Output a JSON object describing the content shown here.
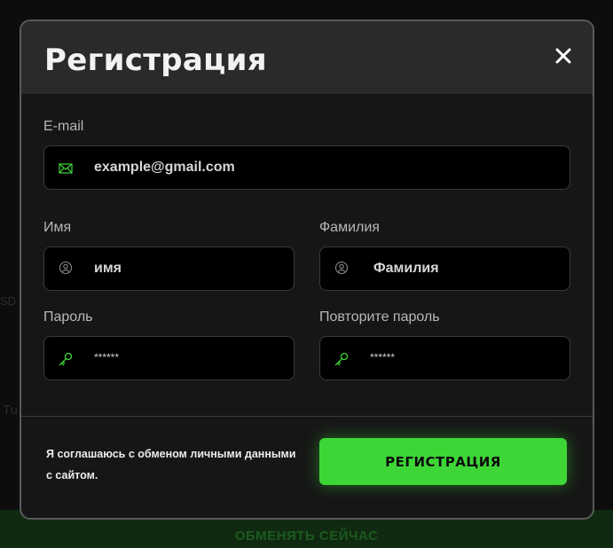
{
  "background": {
    "cta_label": "ОБМЕНЯТЬ СЕЙЧАС",
    "fragments": [
      "SD",
      "Tu"
    ]
  },
  "modal": {
    "title": "Регистрация",
    "email": {
      "label": "E-mail",
      "value": "example@gmail.com",
      "icon": "mail-icon"
    },
    "first_name": {
      "label": "Имя",
      "value": "имя",
      "icon": "user-icon"
    },
    "last_name": {
      "label": "Фамилия",
      "value": "Фамилия",
      "icon": "user-icon"
    },
    "password": {
      "label": "Пароль",
      "value": "******",
      "icon": "key-icon"
    },
    "password_repeat": {
      "label": "Повторите пароль",
      "value": "******",
      "icon": "key-icon"
    },
    "consent_text": "Я соглашаюсь с обменом личными данными с сайтом.",
    "submit_label": "РЕГИСТРАЦИЯ"
  },
  "colors": {
    "accent": "#3ed637",
    "modal_bg": "#161616",
    "header_bg": "#2a2a2a",
    "input_bg": "#000000"
  }
}
